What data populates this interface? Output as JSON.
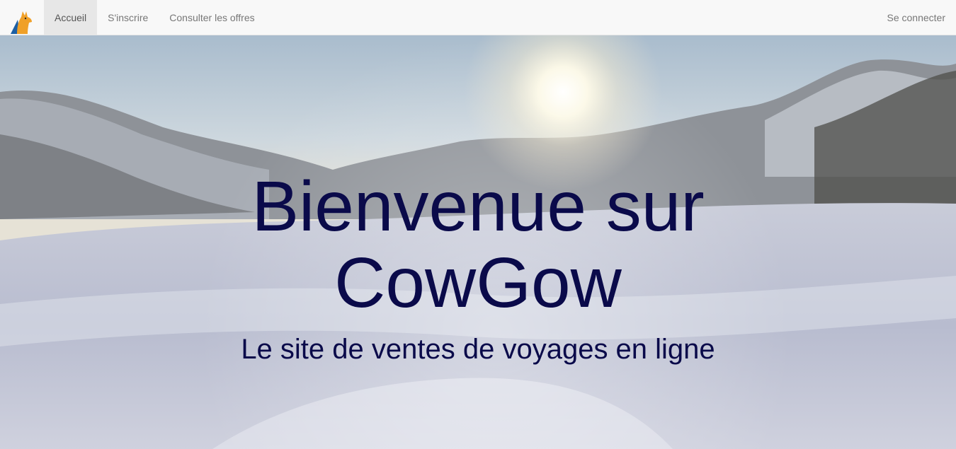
{
  "navbar": {
    "brand_icon": "cowgow-logo-icon",
    "left_items": [
      {
        "label": "Accueil",
        "active": true
      },
      {
        "label": "S'inscrire",
        "active": false
      },
      {
        "label": "Consulter les offres",
        "active": false
      }
    ],
    "right_items": [
      {
        "label": "Se connecter"
      }
    ]
  },
  "hero": {
    "title_line1": "Bienvenue sur",
    "title_line2": "CowGow",
    "subtitle": "Le site de ventes de voyages en ligne",
    "background": "snowy-mountain-sunrise-image"
  },
  "colors": {
    "title": "#0a0a4a",
    "navbar_bg": "#f8f8f8",
    "active_tab_bg": "#e7e7e7",
    "nav_text": "#777777"
  }
}
